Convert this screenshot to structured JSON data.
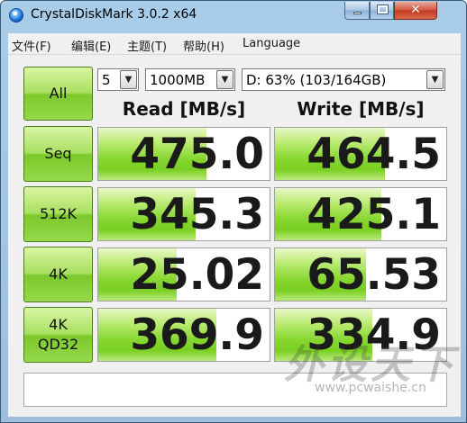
{
  "window": {
    "title": "CrystalDiskMark 3.0.2 x64",
    "caption_buttons": {
      "minimize": "",
      "maximize": "",
      "close": "✕"
    }
  },
  "menu": [
    "文件(F)",
    "编辑(E)",
    "主题(T)",
    "帮助(H)",
    "Language"
  ],
  "controls": {
    "all_button": "All",
    "runs": "5",
    "size": "1000MB",
    "drive": "D: 63% (103/164GB)"
  },
  "headers": {
    "read": "Read [MB/s]",
    "write": "Write [MB/s]"
  },
  "tests": [
    {
      "label": "Seq",
      "label2": "",
      "read": "475.0",
      "write": "464.5",
      "read_fill": 0.63,
      "write_fill": 0.64
    },
    {
      "label": "512K",
      "label2": "",
      "read": "345.3",
      "write": "425.1",
      "read_fill": 0.57,
      "write_fill": 0.62
    },
    {
      "label": "4K",
      "label2": "",
      "read": "25.02",
      "write": "65.53",
      "read_fill": 0.46,
      "write_fill": 0.53
    },
    {
      "label": "4K",
      "label2": "QD32",
      "read": "369.9",
      "write": "334.9",
      "read_fill": 0.69,
      "write_fill": 0.57
    }
  ],
  "comment": "",
  "watermark": {
    "logo": "外设天下",
    "url": "www.pcwaishe.cn"
  },
  "colors": {
    "title_bg": "#a9cde9",
    "green_button": "#96d84a",
    "bar_green": "#7acf22",
    "close_red": "#c23a1f"
  }
}
